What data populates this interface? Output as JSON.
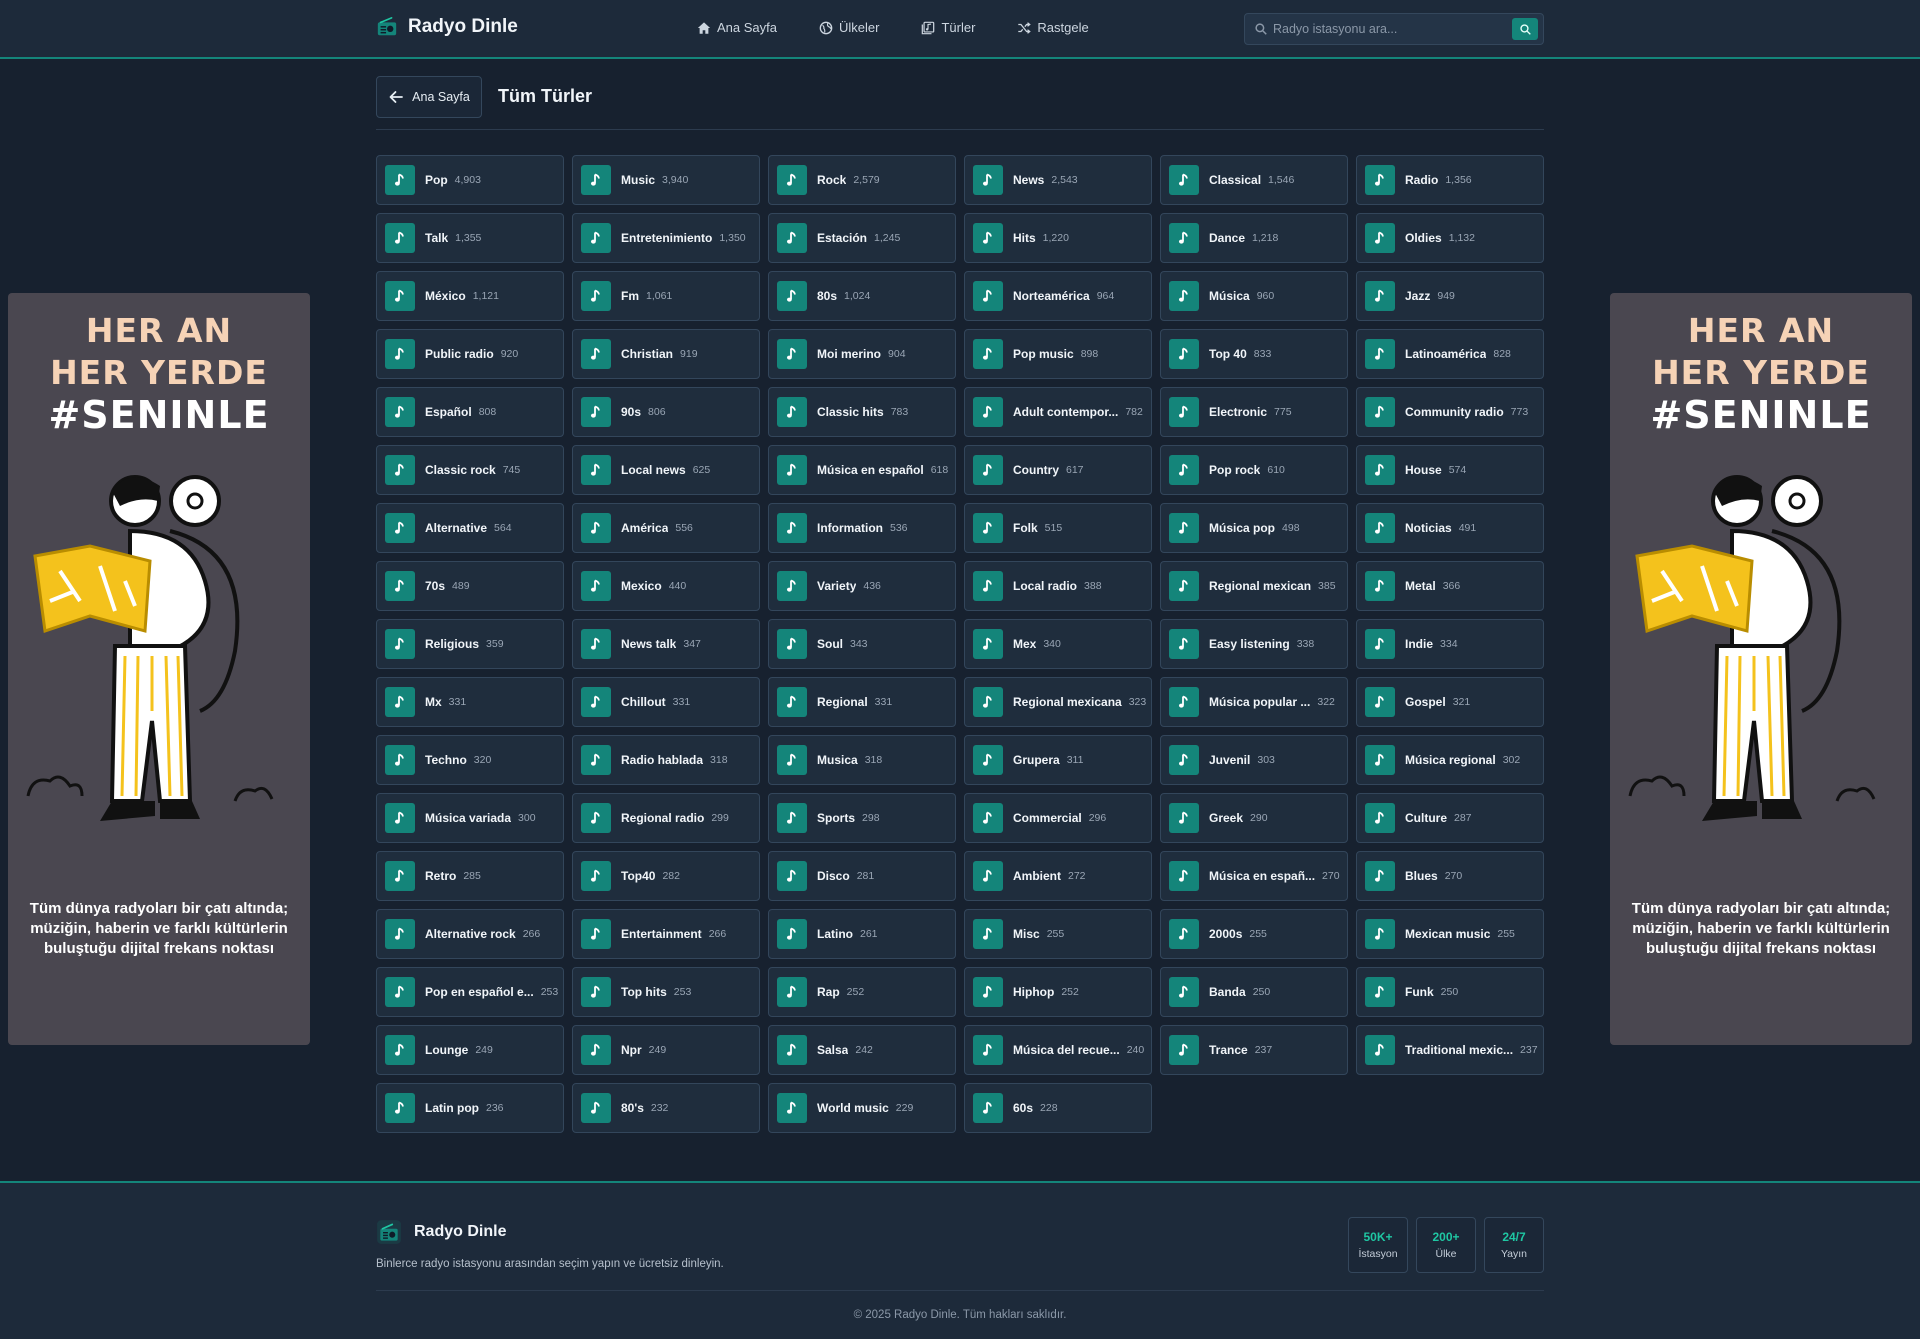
{
  "header": {
    "brand": "Radyo Dinle",
    "nav": [
      {
        "label": "Ana Sayfa",
        "icon": "home-icon"
      },
      {
        "label": "Ülkeler",
        "icon": "globe-icon"
      },
      {
        "label": "Türler",
        "icon": "music-library-icon"
      },
      {
        "label": "Rastgele",
        "icon": "shuffle-icon"
      }
    ],
    "search_placeholder": "Radyo istasyonu ara...",
    "search_value": ""
  },
  "page": {
    "back_label": "Ana Sayfa",
    "title": "Tüm Türler"
  },
  "genres": [
    {
      "name": "Pop",
      "count": "4,903"
    },
    {
      "name": "Music",
      "count": "3,940"
    },
    {
      "name": "Rock",
      "count": "2,579"
    },
    {
      "name": "News",
      "count": "2,543"
    },
    {
      "name": "Classical",
      "count": "1,546"
    },
    {
      "name": "Radio",
      "count": "1,356"
    },
    {
      "name": "Talk",
      "count": "1,355"
    },
    {
      "name": "Entretenimiento",
      "count": "1,350"
    },
    {
      "name": "Estación",
      "count": "1,245"
    },
    {
      "name": "Hits",
      "count": "1,220"
    },
    {
      "name": "Dance",
      "count": "1,218"
    },
    {
      "name": "Oldies",
      "count": "1,132"
    },
    {
      "name": "México",
      "count": "1,121"
    },
    {
      "name": "Fm",
      "count": "1,061"
    },
    {
      "name": "80s",
      "count": "1,024"
    },
    {
      "name": "Norteamérica",
      "count": "964"
    },
    {
      "name": "Música",
      "count": "960"
    },
    {
      "name": "Jazz",
      "count": "949"
    },
    {
      "name": "Public radio",
      "count": "920"
    },
    {
      "name": "Christian",
      "count": "919"
    },
    {
      "name": "Moi merino",
      "count": "904"
    },
    {
      "name": "Pop music",
      "count": "898"
    },
    {
      "name": "Top 40",
      "count": "833"
    },
    {
      "name": "Latinoamérica",
      "count": "828"
    },
    {
      "name": "Español",
      "count": "808"
    },
    {
      "name": "90s",
      "count": "806"
    },
    {
      "name": "Classic hits",
      "count": "783"
    },
    {
      "name": "Adult contempor...",
      "count": "782"
    },
    {
      "name": "Electronic",
      "count": "775"
    },
    {
      "name": "Community radio",
      "count": "773"
    },
    {
      "name": "Classic rock",
      "count": "745"
    },
    {
      "name": "Local news",
      "count": "625"
    },
    {
      "name": "Música en español",
      "count": "618"
    },
    {
      "name": "Country",
      "count": "617"
    },
    {
      "name": "Pop rock",
      "count": "610"
    },
    {
      "name": "House",
      "count": "574"
    },
    {
      "name": "Alternative",
      "count": "564"
    },
    {
      "name": "América",
      "count": "556"
    },
    {
      "name": "Information",
      "count": "536"
    },
    {
      "name": "Folk",
      "count": "515"
    },
    {
      "name": "Música pop",
      "count": "498"
    },
    {
      "name": "Noticias",
      "count": "491"
    },
    {
      "name": "70s",
      "count": "489"
    },
    {
      "name": "Mexico",
      "count": "440"
    },
    {
      "name": "Variety",
      "count": "436"
    },
    {
      "name": "Local radio",
      "count": "388"
    },
    {
      "name": "Regional mexican",
      "count": "385"
    },
    {
      "name": "Metal",
      "count": "366"
    },
    {
      "name": "Religious",
      "count": "359"
    },
    {
      "name": "News talk",
      "count": "347"
    },
    {
      "name": "Soul",
      "count": "343"
    },
    {
      "name": "Mex",
      "count": "340"
    },
    {
      "name": "Easy listening",
      "count": "338"
    },
    {
      "name": "Indie",
      "count": "334"
    },
    {
      "name": "Mx",
      "count": "331"
    },
    {
      "name": "Chillout",
      "count": "331"
    },
    {
      "name": "Regional",
      "count": "331"
    },
    {
      "name": "Regional mexicana",
      "count": "323"
    },
    {
      "name": "Música popular ...",
      "count": "322"
    },
    {
      "name": "Gospel",
      "count": "321"
    },
    {
      "name": "Techno",
      "count": "320"
    },
    {
      "name": "Radio hablada",
      "count": "318"
    },
    {
      "name": "Musica",
      "count": "318"
    },
    {
      "name": "Grupera",
      "count": "311"
    },
    {
      "name": "Juvenil",
      "count": "303"
    },
    {
      "name": "Música regional",
      "count": "302"
    },
    {
      "name": "Música variada",
      "count": "300"
    },
    {
      "name": "Regional radio",
      "count": "299"
    },
    {
      "name": "Sports",
      "count": "298"
    },
    {
      "name": "Commercial",
      "count": "296"
    },
    {
      "name": "Greek",
      "count": "290"
    },
    {
      "name": "Culture",
      "count": "287"
    },
    {
      "name": "Retro",
      "count": "285"
    },
    {
      "name": "Top40",
      "count": "282"
    },
    {
      "name": "Disco",
      "count": "281"
    },
    {
      "name": "Ambient",
      "count": "272"
    },
    {
      "name": "Música en españ...",
      "count": "270"
    },
    {
      "name": "Blues",
      "count": "270"
    },
    {
      "name": "Alternative rock",
      "count": "266"
    },
    {
      "name": "Entertainment",
      "count": "266"
    },
    {
      "name": "Latino",
      "count": "261"
    },
    {
      "name": "Misc",
      "count": "255"
    },
    {
      "name": "2000s",
      "count": "255"
    },
    {
      "name": "Mexican music",
      "count": "255"
    },
    {
      "name": "Pop en español e...",
      "count": "253"
    },
    {
      "name": "Top hits",
      "count": "253"
    },
    {
      "name": "Rap",
      "count": "252"
    },
    {
      "name": "Hiphop",
      "count": "252"
    },
    {
      "name": "Banda",
      "count": "250"
    },
    {
      "name": "Funk",
      "count": "250"
    },
    {
      "name": "Lounge",
      "count": "249"
    },
    {
      "name": "Npr",
      "count": "249"
    },
    {
      "name": "Salsa",
      "count": "242"
    },
    {
      "name": "Música del recue...",
      "count": "240"
    },
    {
      "name": "Trance",
      "count": "237"
    },
    {
      "name": "Traditional mexic...",
      "count": "237"
    },
    {
      "name": "Latin pop",
      "count": "236"
    },
    {
      "name": "80's",
      "count": "232"
    },
    {
      "name": "World music",
      "count": "229"
    },
    {
      "name": "60s",
      "count": "228"
    }
  ],
  "banner": {
    "line1": "HER AN",
    "line2": "HER YERDE",
    "line3": "#SENINLE",
    "text": "Tüm dünya radyoları bir çatı altında; müziğin, haberin ve farklı kültürlerin buluştuğu dijital frekans noktası"
  },
  "footer": {
    "brand": "Radyo Dinle",
    "description": "Binlerce radyo istasyonu arasından seçim yapın ve ücretsiz dinleyin.",
    "stats": [
      {
        "value": "50K+",
        "label": "İstasyon"
      },
      {
        "value": "200+",
        "label": "Ülke"
      },
      {
        "value": "24/7",
        "label": "Yayın"
      }
    ],
    "copyright": "© 2025 Radyo Dinle. Tüm hakları saklıdır."
  },
  "colors": {
    "accent": "#14857a",
    "background": "#17212f",
    "card": "#1f2d3d",
    "banner_bg": "#4a4750",
    "banner_heading": "#f6d3b6",
    "stat_value": "#1fc7a3"
  }
}
